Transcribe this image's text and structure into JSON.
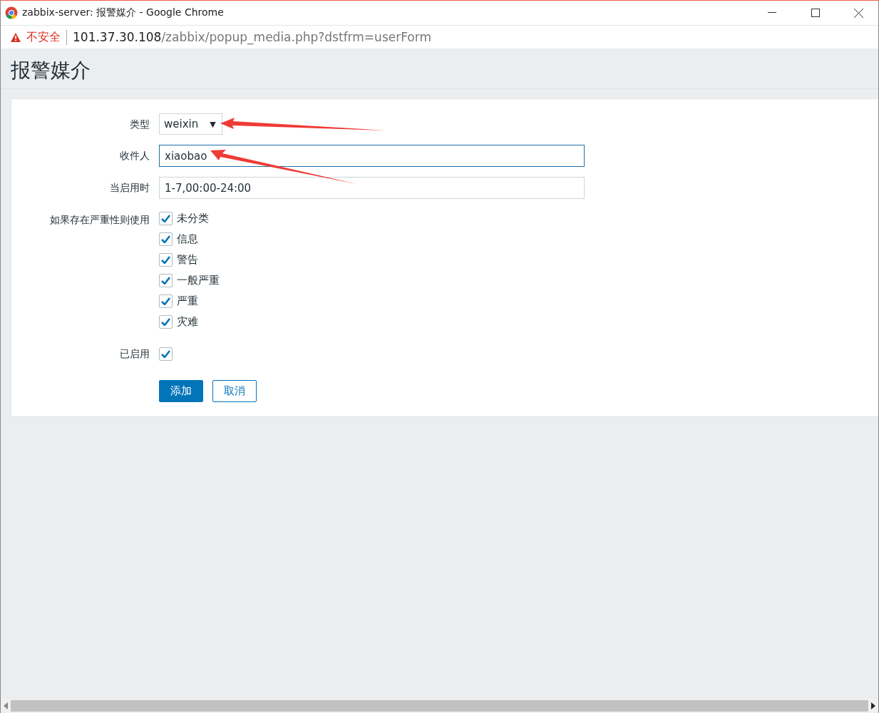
{
  "window": {
    "title": "zabbix-server: 报警媒介 - Google Chrome"
  },
  "address_bar": {
    "security": "不安全",
    "host": "101.37.30.108",
    "path": "/zabbix/popup_media.php?dstfrm=userForm"
  },
  "page": {
    "heading": "报警媒介"
  },
  "form": {
    "type": {
      "label": "类型",
      "value": "weixin",
      "caret": "▼"
    },
    "send_to": {
      "label": "收件人",
      "value": "xiaobao"
    },
    "when_active": {
      "label": "当启用时",
      "value": "1-7,00:00-24:00"
    },
    "severity": {
      "label": "如果存在严重性则使用",
      "options": [
        {
          "label": "未分类",
          "checked": true
        },
        {
          "label": "信息",
          "checked": true
        },
        {
          "label": "警告",
          "checked": true
        },
        {
          "label": "一般严重",
          "checked": true
        },
        {
          "label": "严重",
          "checked": true
        },
        {
          "label": "灾难",
          "checked": true
        }
      ]
    },
    "enabled": {
      "label": "已启用",
      "checked": true
    },
    "buttons": [
      {
        "label": "添加",
        "kind": "primary"
      },
      {
        "label": "取消",
        "kind": "secondary"
      }
    ]
  }
}
